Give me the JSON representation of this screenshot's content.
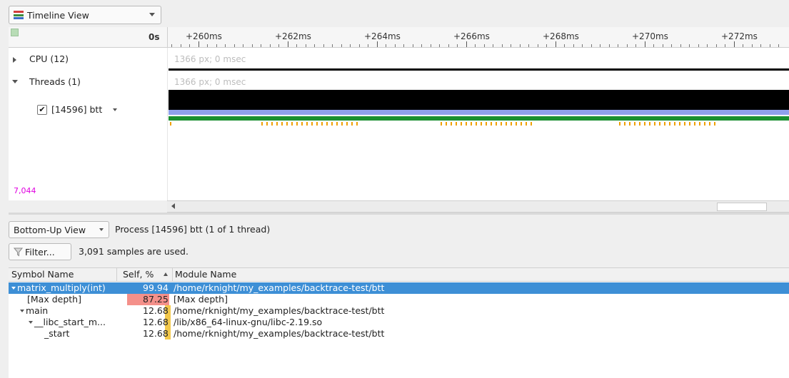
{
  "top": {
    "view_combo": "Timeline View",
    "icon": "timeline-view-icon"
  },
  "ruler": {
    "zero": "0s",
    "ticks": [
      "+260ms",
      "+262ms",
      "+264ms",
      "+266ms",
      "+268ms",
      "+270ms",
      "+272ms"
    ]
  },
  "tracks": {
    "cpu": {
      "label": "CPU (12)",
      "info": "1366 px; 0 msec"
    },
    "threads": {
      "label": "Threads (1)",
      "info": "1366 px; 0 msec"
    },
    "thread": {
      "label": "[14596] btt",
      "checked": true
    },
    "count": "7,044"
  },
  "bottom": {
    "view_combo": "Bottom-Up View",
    "process_info": "Process [14596] btt (1 of 1 thread)",
    "filter_button": "Filter...",
    "samples_info": "3,091 samples are used."
  },
  "table": {
    "columns": [
      "Symbol Name",
      "Self, %",
      "Module Name"
    ],
    "sort_column": "Self, %",
    "rows": [
      {
        "symbol": "matrix_multiply(int)",
        "self": "99.94",
        "module": "/home/rknight/my_examples/backtrace-test/btt",
        "selected": true,
        "depth": 0,
        "expanded": true,
        "self_fraction": 0.9994
      },
      {
        "symbol": "[Max depth]",
        "self": "87.25",
        "module": "[Max depth]",
        "selected": false,
        "depth": 1,
        "expanded": false,
        "self_fraction": 0.8725
      },
      {
        "symbol": "main",
        "self": "12.68",
        "module": "/home/rknight/my_examples/backtrace-test/btt",
        "selected": false,
        "depth": 1,
        "expanded": true,
        "self_fraction": 0.1268
      },
      {
        "symbol": "__libc_start_m...",
        "self": "12.68",
        "module": "/lib/x86_64-linux-gnu/libc-2.19.so",
        "selected": false,
        "depth": 2,
        "expanded": true,
        "self_fraction": 0.1268
      },
      {
        "symbol": "_start",
        "self": "12.68",
        "module": "/home/rknight/my_examples/backtrace-test/btt",
        "selected": false,
        "depth": 3,
        "expanded": false,
        "self_fraction": 0.1268
      }
    ]
  },
  "colors": {
    "selection": "#3d8fd6",
    "heat_high": "#f4908a",
    "heat_low": "#f3c84a",
    "track_black": "#000000",
    "track_blue": "#8fa0ec",
    "track_green": "#1a8f30",
    "track_samples": "#f0a000",
    "count_magenta": "#e000e0"
  }
}
